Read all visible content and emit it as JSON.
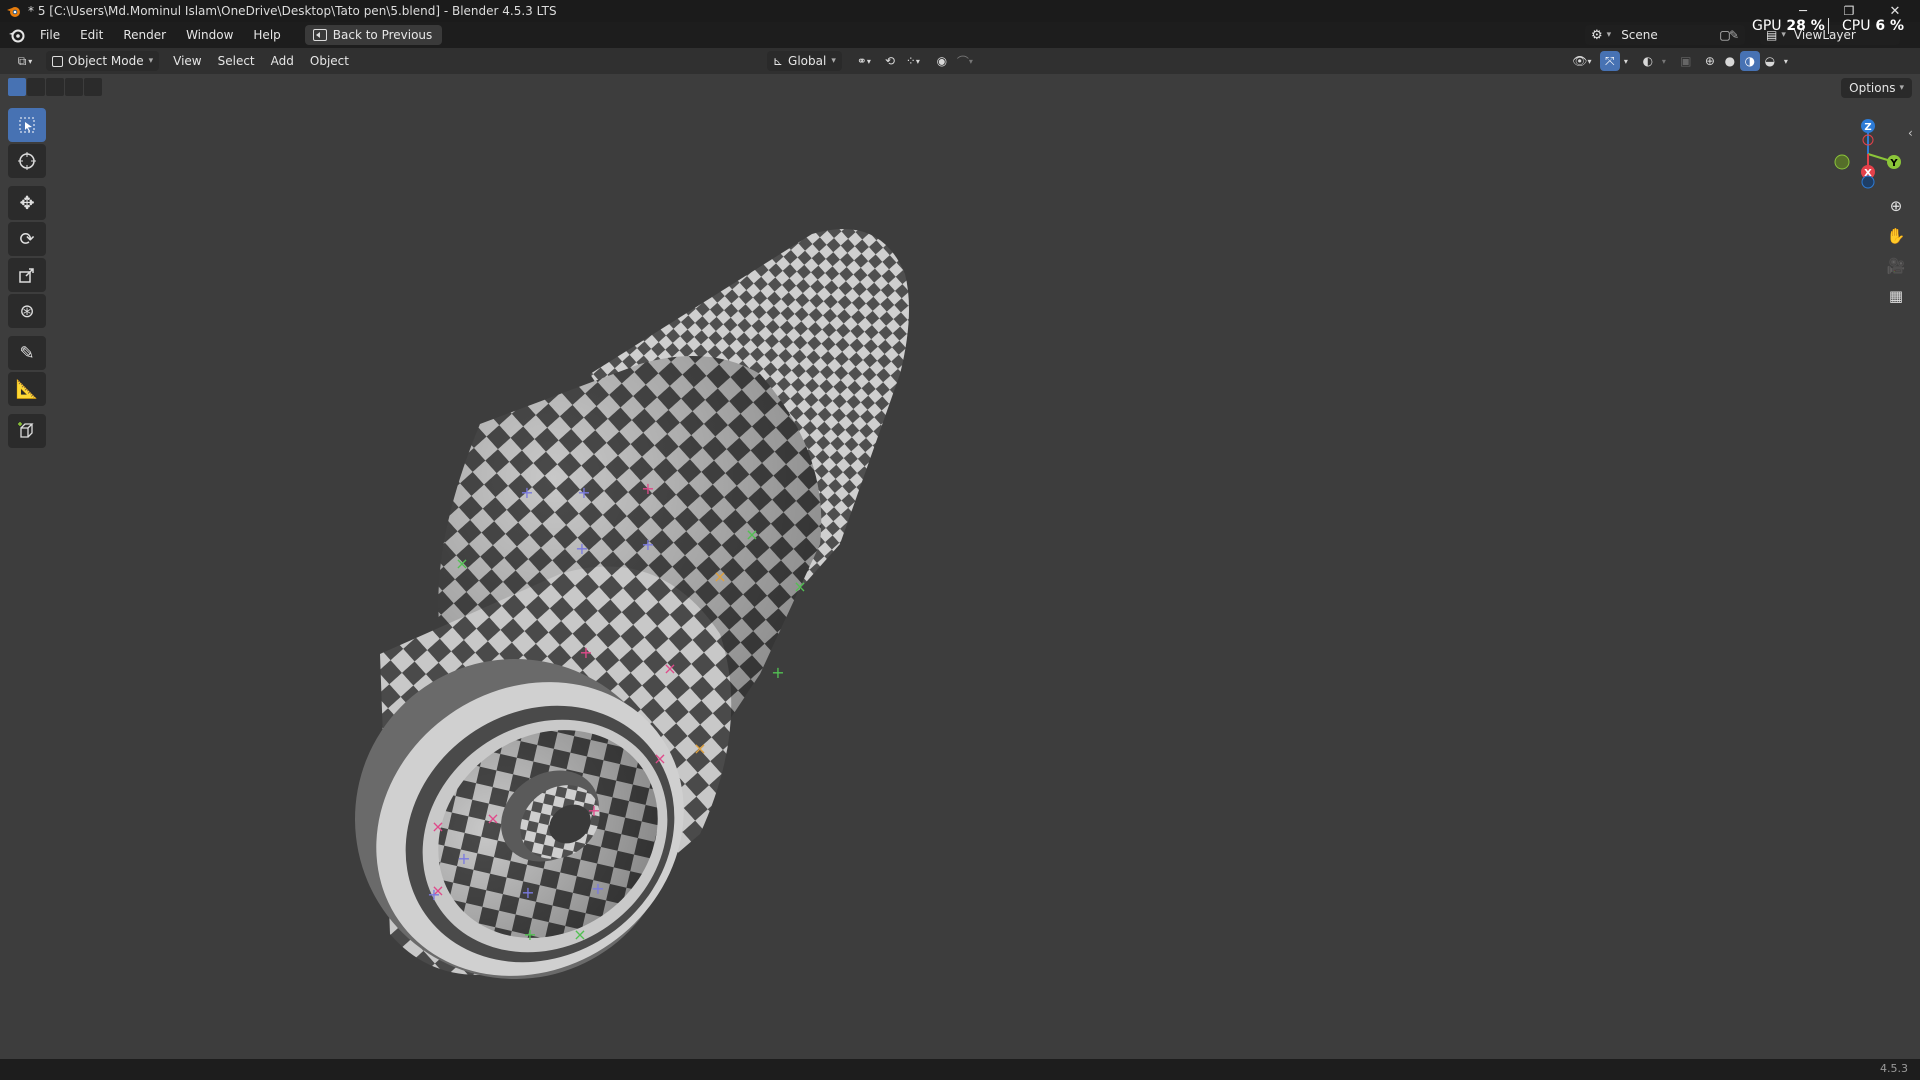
{
  "window": {
    "title": "* 5 [C:\\Users\\Md.Mominul Islam\\OneDrive\\Desktop\\Tato pen\\5.blend] - Blender 4.5.3 LTS",
    "minimize": "─",
    "maximize": "❐",
    "close": "✕"
  },
  "menu": {
    "items": [
      "File",
      "Edit",
      "Render",
      "Window",
      "Help"
    ],
    "back_button": "Back to Previous"
  },
  "scene": {
    "scene_name": "Scene",
    "view_layer": "ViewLayer"
  },
  "performance": {
    "gpu_label": "GPU",
    "gpu_value": "28 %",
    "cpu_label": "CPU",
    "cpu_value": "6 %"
  },
  "viewport_header": {
    "mode": "Object Mode",
    "menus": [
      "View",
      "Select",
      "Add",
      "Object"
    ],
    "orientation": "Global",
    "options": "Options"
  },
  "tools": [
    {
      "name": "select-box",
      "icon": "select-box-icon",
      "active": true
    },
    {
      "name": "cursor",
      "icon": "cursor-icon",
      "active": false
    },
    {
      "name": "move",
      "icon": "move-icon",
      "active": false
    },
    {
      "name": "rotate",
      "icon": "rotate-icon",
      "active": false
    },
    {
      "name": "scale",
      "icon": "scale-icon",
      "active": false
    },
    {
      "name": "transform",
      "icon": "transform-icon",
      "active": false
    },
    {
      "name": "annotate",
      "icon": "annotate-icon",
      "active": false
    },
    {
      "name": "measure",
      "icon": "measure-icon",
      "active": false
    },
    {
      "name": "add-cube",
      "icon": "add-cube-icon",
      "active": false
    }
  ],
  "gizmo": {
    "x": "X",
    "y": "Y",
    "z": "Z"
  },
  "colors": {
    "accent": "#4772b3",
    "viewport_bg": "#3d3d3d",
    "axis_x": "#e5414a",
    "axis_y": "#8bc539",
    "axis_z": "#2d7bd6"
  },
  "statusbar": {
    "version": "4.5.3"
  }
}
